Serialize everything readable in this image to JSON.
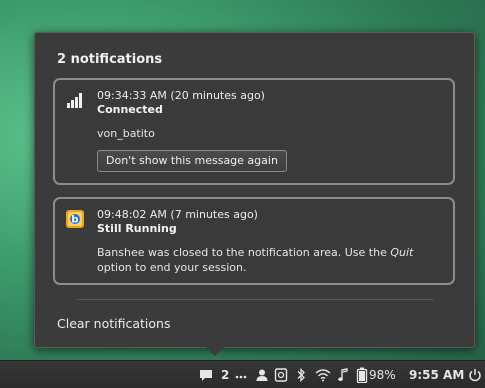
{
  "popup": {
    "title": "2 notifications",
    "notifications": [
      {
        "icon": "signal-bars-icon",
        "timestamp": "09:34:33 AM (20 minutes ago)",
        "title": "Connected",
        "body": "von_batito",
        "action_label": "Don't show this message again"
      },
      {
        "icon": "banshee-icon",
        "timestamp": "09:48:02 AM (7 minutes ago)",
        "title": "Still Running",
        "body_pre": "Banshee was closed to the notification area. Use the ",
        "body_em": "Quit",
        "body_post": " option to end your session."
      }
    ],
    "clear_label": "Clear notifications"
  },
  "panel": {
    "notification_count": "2",
    "battery_percent": "98%",
    "clock": "9:55 AM"
  }
}
